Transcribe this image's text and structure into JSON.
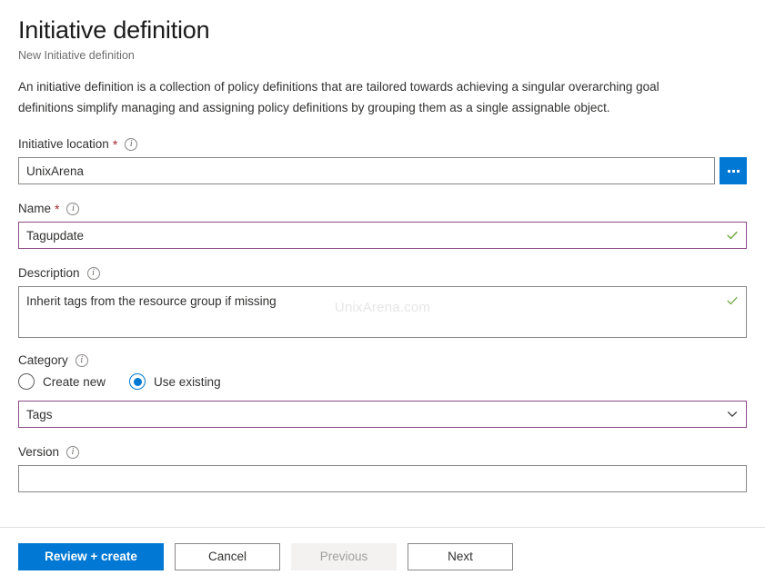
{
  "header": {
    "title": "Initiative definition",
    "subtitle": "New Initiative definition"
  },
  "intro": {
    "line1": "An initiative definition is a collection of policy definitions that are tailored towards achieving a singular overarching goal",
    "line2": "definitions simplify managing and assigning policy definitions by grouping them as a single assignable object."
  },
  "form": {
    "initiative_location": {
      "label": "Initiative location",
      "required_mark": "*",
      "info_glyph": "i",
      "value": "UnixArena",
      "placeholder": "",
      "browse_button_label": "..."
    },
    "name": {
      "label": "Name",
      "required_mark": "*",
      "info_glyph": "i",
      "value": "Tagupdate",
      "placeholder": "",
      "valid": true
    },
    "description": {
      "label": "Description",
      "info_glyph": "i",
      "value": "Inherit tags from the resource group if missing",
      "placeholder": "",
      "valid": true,
      "watermark": "UnixArena.com"
    },
    "category": {
      "label": "Category",
      "info_glyph": "i",
      "options": [
        {
          "label": "Create new",
          "selected": false
        },
        {
          "label": "Use existing",
          "selected": true
        }
      ],
      "select_value": "Tags",
      "select_options": [
        "Tags"
      ]
    },
    "version": {
      "label": "Version",
      "info_glyph": "i",
      "value": "",
      "placeholder": ""
    }
  },
  "footer": {
    "review_create": "Review + create",
    "cancel": "Cancel",
    "previous": "Previous",
    "next": "Next"
  },
  "colors": {
    "accent_blue": "#0078d4",
    "field_accent": "#8c4a86",
    "valid_green": "#6ea63b",
    "required_red": "#a4262c"
  }
}
